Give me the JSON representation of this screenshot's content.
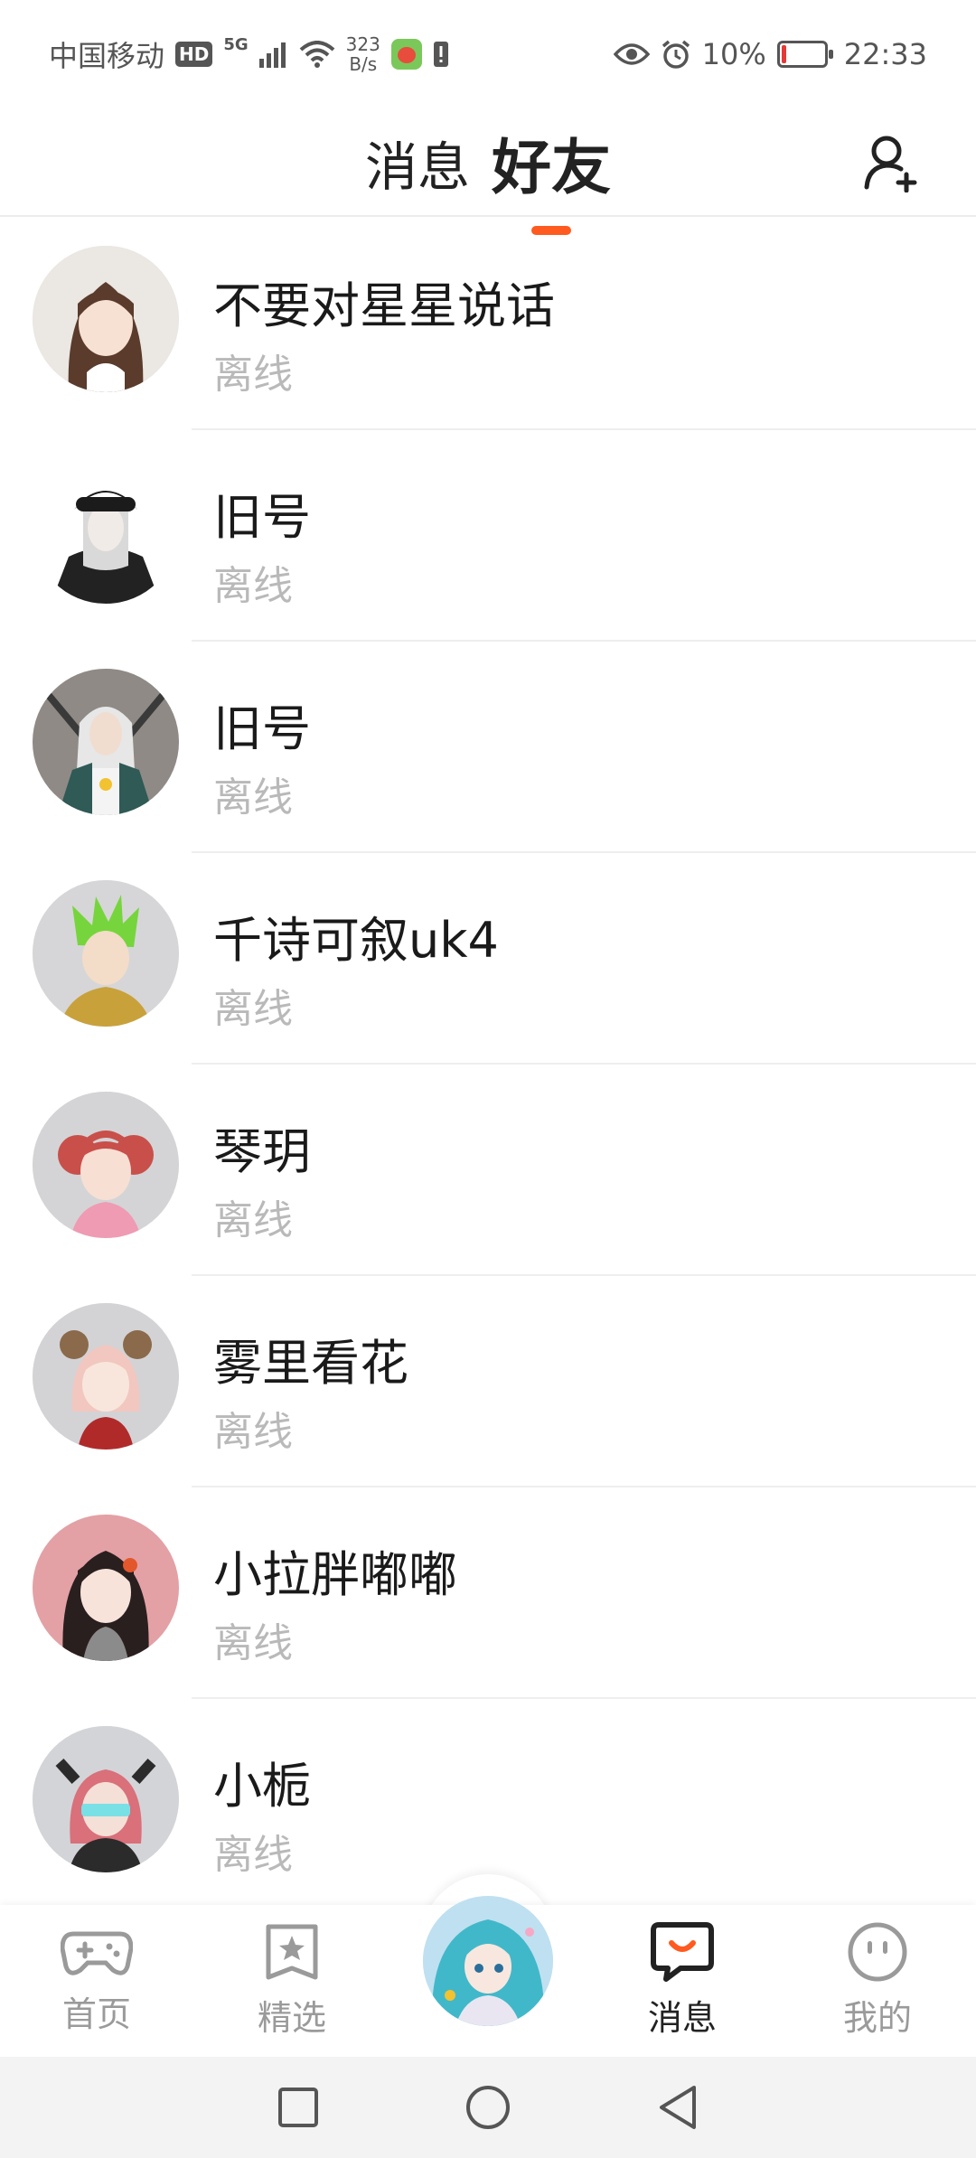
{
  "status_bar": {
    "carrier": "中国移动",
    "hd": "HD",
    "signal_type": "5G",
    "net_speed_value": "323",
    "net_speed_unit": "B/s",
    "battery": "10%",
    "time": "22:33"
  },
  "header": {
    "tab_messages": "消息",
    "tab_friends": "好友",
    "active_tab": "好友"
  },
  "friends": [
    {
      "name": "不要对星星说话",
      "status": "离线"
    },
    {
      "name": "旧号",
      "status": "离线"
    },
    {
      "name": "旧号",
      "status": "离线"
    },
    {
      "name": "千诗可叙uk4",
      "status": "离线"
    },
    {
      "name": "琴玥",
      "status": "离线"
    },
    {
      "name": "雾里看花",
      "status": "离线"
    },
    {
      "name": "小拉胖嘟嘟",
      "status": "离线"
    },
    {
      "name": "小栀",
      "status": "离线"
    }
  ],
  "bottom_nav": {
    "home": "首页",
    "featured": "精选",
    "messages": "消息",
    "mine": "我的",
    "active": "消息"
  },
  "colors": {
    "accent": "#ff5a1f",
    "muted_text": "#b9b9b9",
    "battery_low": "#e53935"
  }
}
